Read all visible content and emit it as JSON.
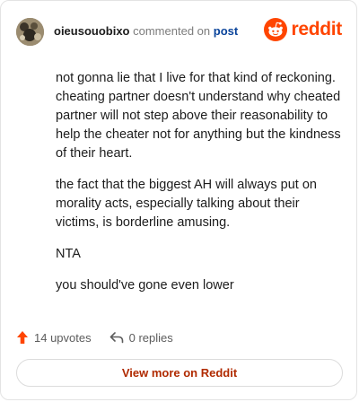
{
  "comment": {
    "username": "oieusouobixo",
    "action_text": "commented on",
    "post_link_text": "post",
    "paragraphs": [
      "not gonna lie that I live for that kind of reckoning. cheating partner doesn't understand why cheated partner will not step above their reasonability to help the cheater not for anything but the kindness of their heart.",
      "the fact that the biggest AH will always put on morality acts, especially talking about their victims, is borderline amusing.",
      "NTA",
      "you should've gone even lower"
    ]
  },
  "brand": {
    "wordmark": "reddit",
    "color": "#ff4500",
    "icon": "reddit-snoo-icon"
  },
  "actions": {
    "upvotes_label": "14 upvotes",
    "replies_label": "0 replies",
    "upvote_icon": "upvote-arrow-icon",
    "reply_icon": "reply-arrow-icon",
    "upvote_color": "#ff4500"
  },
  "footer": {
    "view_more_label": "View more on Reddit"
  }
}
